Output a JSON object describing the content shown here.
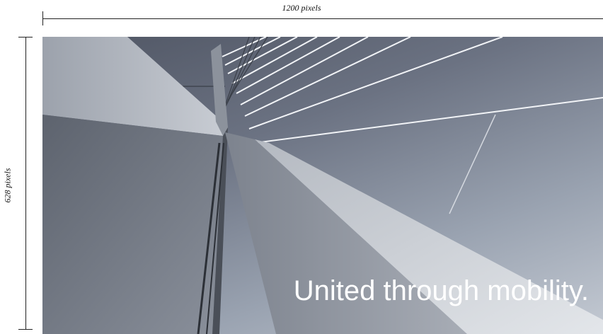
{
  "dimensions": {
    "width_label": "1200 pixels",
    "height_label": "628 pixels"
  },
  "banner": {
    "tagline": "United through mobility."
  },
  "colors": {
    "tagline": "#ffffff",
    "sky_top": "#4f5563",
    "sky_bottom": "#c4cad3",
    "pylon_light": "#d9dde3",
    "pylon_dark": "#6e7480"
  }
}
